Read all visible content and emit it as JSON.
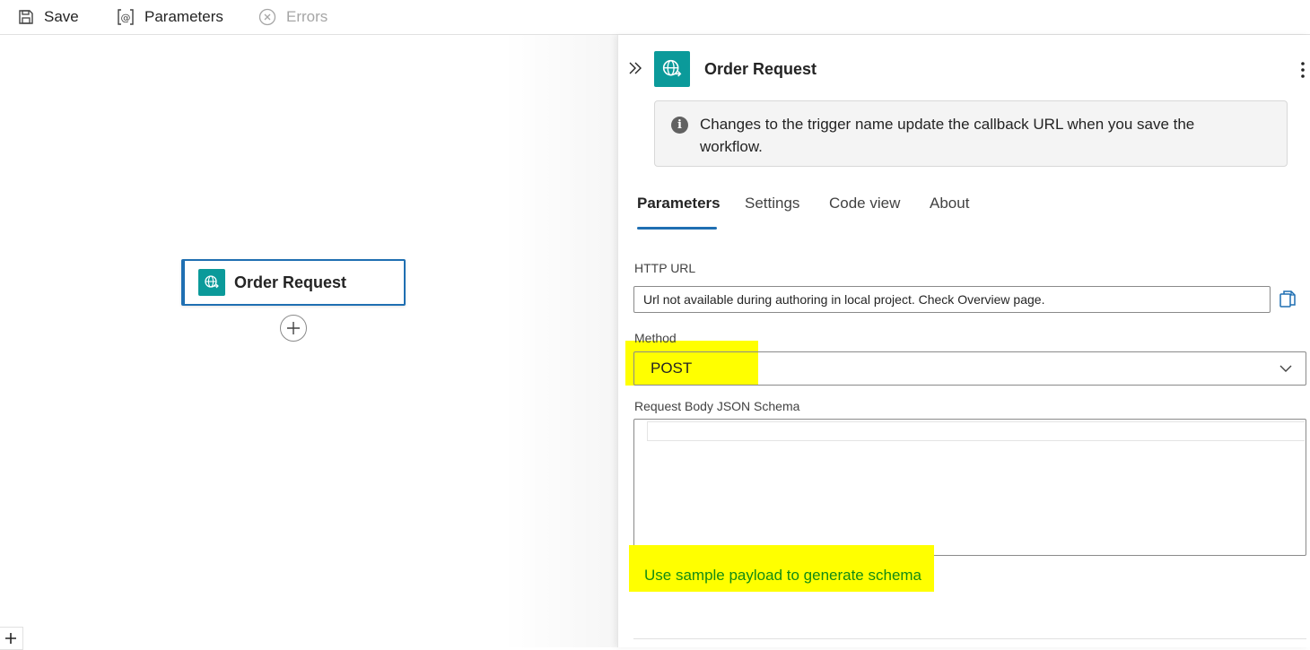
{
  "toolbar": {
    "save_label": "Save",
    "parameters_label": "Parameters",
    "errors_label": "Errors"
  },
  "canvas": {
    "node_title": "Order Request",
    "node_icon": "globe-request-icon",
    "add_icon": "plus-circle-icon"
  },
  "panel": {
    "title": "Order Request",
    "icon": "globe-request-icon",
    "info_text": "Changes to the trigger name update the callback URL when you save the workflow.",
    "tabs": [
      {
        "label": "Parameters",
        "active": true
      },
      {
        "label": "Settings",
        "active": false
      },
      {
        "label": "Code view",
        "active": false
      },
      {
        "label": "About",
        "active": false
      }
    ],
    "http_url_label": "HTTP URL",
    "http_url_value": "Url not available during authoring in local project. Check Overview page.",
    "method_label": "Method",
    "method_value": "POST",
    "schema_label": "Request Body JSON Schema",
    "schema_link": "Use sample payload to generate schema"
  },
  "colors": {
    "accent": "#1f6fb2",
    "trigger_icon_bg": "#0b9a9a",
    "link": "#138c13",
    "highlight": "#ffff00"
  }
}
